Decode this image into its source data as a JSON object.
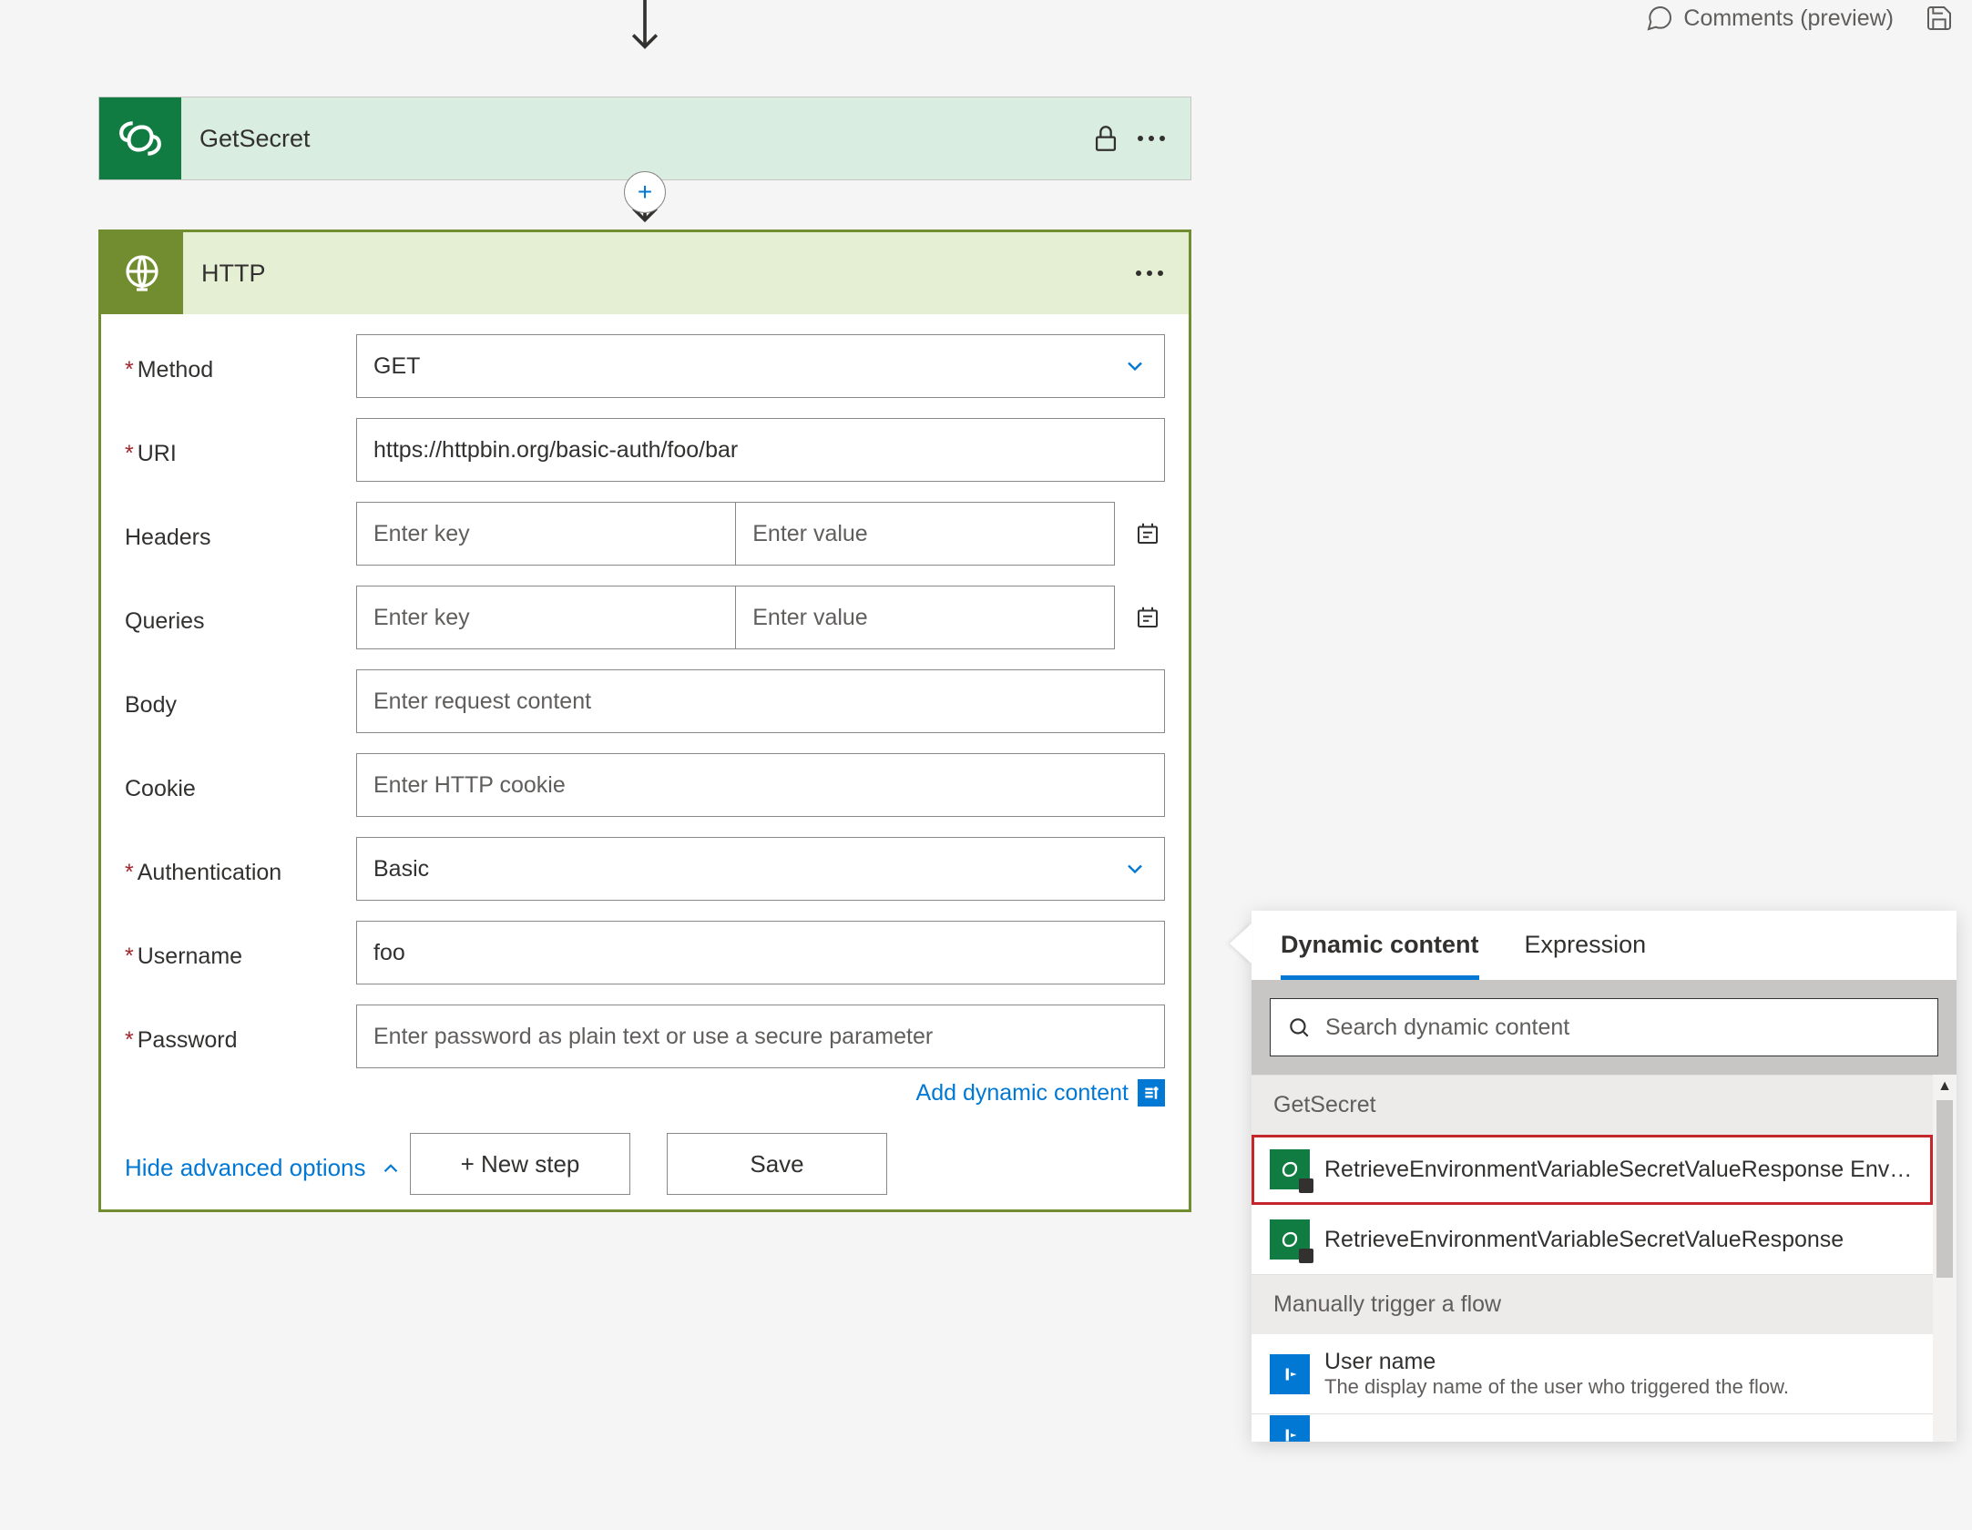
{
  "topbar": {
    "comments_label": "Comments (preview)"
  },
  "get_secret": {
    "title": "GetSecret"
  },
  "http": {
    "title": "HTTP",
    "labels": {
      "method": "Method",
      "uri": "URI",
      "headers": "Headers",
      "queries": "Queries",
      "body": "Body",
      "cookie": "Cookie",
      "authentication": "Authentication",
      "username": "Username",
      "password": "Password"
    },
    "values": {
      "method": "GET",
      "uri": "https://httpbin.org/basic-auth/foo/bar",
      "authentication": "Basic",
      "username": "foo"
    },
    "placeholders": {
      "key": "Enter key",
      "value": "Enter value",
      "body": "Enter request content",
      "cookie": "Enter HTTP cookie",
      "password": "Enter password as plain text or use a secure parameter"
    },
    "add_dynamic": "Add dynamic content",
    "hide_advanced": "Hide advanced options"
  },
  "buttons": {
    "new_step": "+ New step",
    "save": "Save"
  },
  "dyn": {
    "tabs": {
      "dynamic": "Dynamic content",
      "expression": "Expression"
    },
    "search_placeholder": "Search dynamic content",
    "sections": {
      "getsecret": "GetSecret",
      "manual": "Manually trigger a flow"
    },
    "items": {
      "r1": "RetrieveEnvironmentVariableSecretValueResponse Envi…",
      "r2": "RetrieveEnvironmentVariableSecretValueResponse",
      "username_t": "User name",
      "username_d": "The display name of the user who triggered the flow."
    }
  }
}
